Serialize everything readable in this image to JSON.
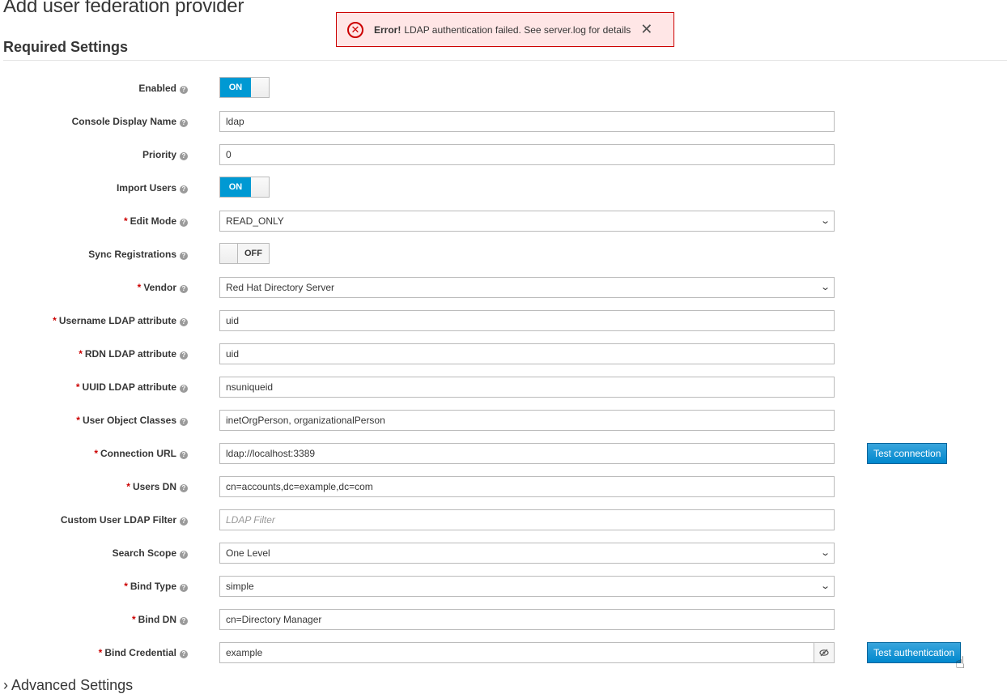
{
  "page": {
    "title": "Add user federation provider",
    "section_title": "Required Settings",
    "advanced_section": "› Advanced Settings"
  },
  "alert": {
    "type": "error",
    "strong": "Error!",
    "message": "LDAP authentication failed. See server.log for details",
    "icon": "error-circle-icon",
    "close_icon": "close-icon",
    "color": "#cc0000"
  },
  "form": {
    "help_glyph": "?",
    "required_marker": "*",
    "fields": {
      "enabled": {
        "label": "Enabled",
        "value": "ON"
      },
      "console_display_name": {
        "label": "Console Display Name",
        "value": "ldap"
      },
      "priority": {
        "label": "Priority",
        "value": "0"
      },
      "import_users": {
        "label": "Import Users",
        "value": "ON"
      },
      "edit_mode": {
        "label": "Edit Mode",
        "value": "READ_ONLY"
      },
      "sync_registrations": {
        "label": "Sync Registrations",
        "value": "OFF"
      },
      "vendor": {
        "label": "Vendor",
        "value": "Red Hat Directory Server"
      },
      "username_ldap_attribute": {
        "label": "Username LDAP attribute",
        "value": "uid"
      },
      "rdn_ldap_attribute": {
        "label": "RDN LDAP attribute",
        "value": "uid"
      },
      "uuid_ldap_attribute": {
        "label": "UUID LDAP attribute",
        "value": "nsuniqueid"
      },
      "user_object_classes": {
        "label": "User Object Classes",
        "value": "inetOrgPerson, organizationalPerson"
      },
      "connection_url": {
        "label": "Connection URL",
        "value": "ldap://localhost:3389"
      },
      "users_dn": {
        "label": "Users DN",
        "value": "cn=accounts,dc=example,dc=com"
      },
      "custom_user_ldap_filter": {
        "label": "Custom User LDAP Filter",
        "value": "",
        "placeholder": "LDAP Filter"
      },
      "search_scope": {
        "label": "Search Scope",
        "value": "One Level"
      },
      "bind_type": {
        "label": "Bind Type",
        "value": "simple"
      },
      "bind_dn": {
        "label": "Bind DN",
        "value": "cn=Directory Manager"
      },
      "bind_credential": {
        "label": "Bind Credential",
        "value": "example"
      }
    }
  },
  "buttons": {
    "test_connection": "Test connection",
    "test_authentication": "Test authentication"
  },
  "colors": {
    "accent": "#0099d3",
    "button": "#0088ce",
    "required": "#cc0000"
  }
}
